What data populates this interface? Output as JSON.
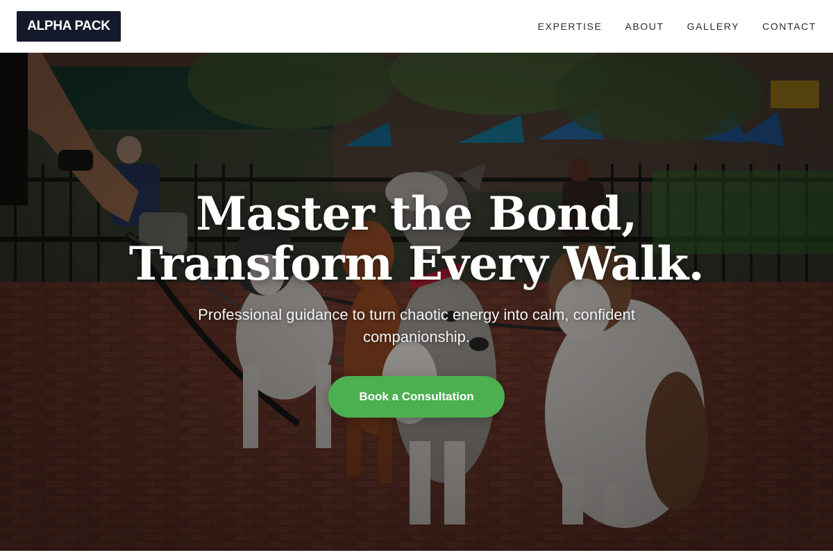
{
  "brand": {
    "logo_text": "ALPHA PACK"
  },
  "nav": {
    "items": [
      {
        "label": "EXPERTISE"
      },
      {
        "label": "ABOUT"
      },
      {
        "label": "GALLERY"
      },
      {
        "label": "CONTACT"
      }
    ]
  },
  "hero": {
    "title_line_1": "Master the Bond,",
    "title_line_2": "Transform Every Walk.",
    "subtitle": "Professional guidance to turn chaotic energy into calm, confident companionship.",
    "cta_label": "Book a Consultation"
  },
  "colors": {
    "logo_background": "#141a2b",
    "cta_background": "#4caf50",
    "nav_text": "#2a2a2a"
  },
  "icons": {
    "background_image": "dogs-on-leashes-photo"
  }
}
